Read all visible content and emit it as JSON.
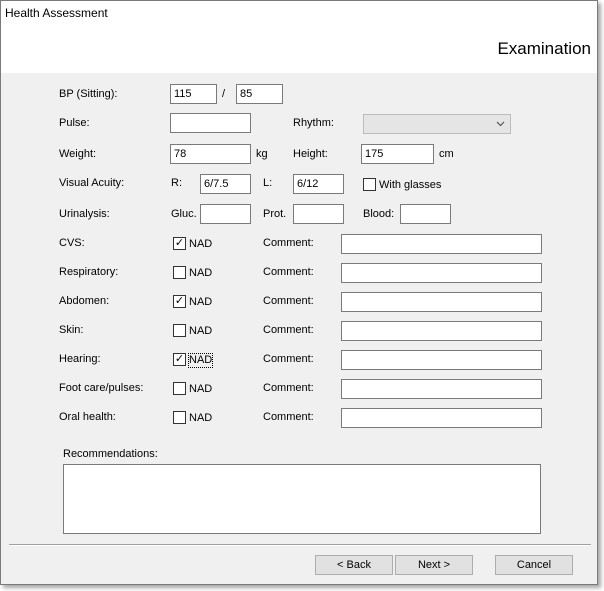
{
  "window": {
    "title": "Health Assessment"
  },
  "header": {
    "title": "Examination"
  },
  "bp": {
    "label": "BP (Sitting):",
    "systolic": "115",
    "separator": "/",
    "diastolic": "85"
  },
  "pulse": {
    "label": "Pulse:",
    "value": ""
  },
  "rhythm": {
    "label": "Rhythm:",
    "selected": ""
  },
  "weight": {
    "label": "Weight:",
    "value": "78",
    "unit": "kg"
  },
  "height": {
    "label": "Height:",
    "value": "175",
    "unit": "cm"
  },
  "visual_acuity": {
    "label": "Visual Acuity:",
    "r_label": "R:",
    "r_value": "6/7.5",
    "l_label": "L:",
    "l_value": "6/12",
    "glasses_label": "With glasses",
    "glasses_checked": false
  },
  "urinalysis": {
    "label": "Urinalysis:",
    "gluc_label": "Gluc.",
    "gluc_value": "",
    "prot_label": "Prot.",
    "prot_value": "",
    "blood_label": "Blood:",
    "blood_value": ""
  },
  "nad_label": "NAD",
  "comment_label": "Comment:",
  "systems": [
    {
      "label": "CVS:",
      "nad": true,
      "comment": ""
    },
    {
      "label": "Respiratory:",
      "nad": false,
      "comment": ""
    },
    {
      "label": "Abdomen:",
      "nad": true,
      "comment": ""
    },
    {
      "label": "Skin:",
      "nad": false,
      "comment": ""
    },
    {
      "label": "Hearing:",
      "nad": true,
      "comment": ""
    },
    {
      "label": "Foot care/pulses:",
      "nad": false,
      "comment": ""
    },
    {
      "label": "Oral health:",
      "nad": false,
      "comment": ""
    }
  ],
  "recommendations": {
    "label": "Recommendations:",
    "value": ""
  },
  "buttons": {
    "back": "< Back",
    "next": "Next >",
    "cancel": "Cancel"
  },
  "icons": {
    "checkmark": "✓",
    "dropdown": "chevron-down-icon"
  }
}
